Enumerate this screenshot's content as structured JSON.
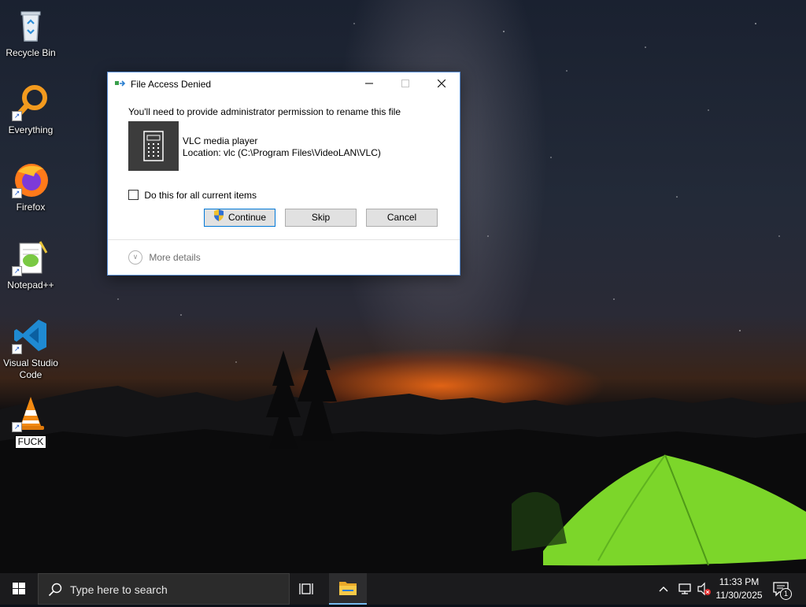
{
  "desktop": {
    "icons": [
      {
        "label": "Recycle Bin",
        "icon": "recycle-bin-icon"
      },
      {
        "label": "Everything",
        "icon": "everything-search-icon"
      },
      {
        "label": "Firefox",
        "icon": "firefox-icon"
      },
      {
        "label": "Notepad++",
        "icon": "notepad-plus-plus-icon"
      },
      {
        "label": "Visual Studio Code",
        "icon": "vscode-icon"
      },
      {
        "label": "FUCK",
        "icon": "vlc-cone-icon"
      }
    ]
  },
  "dialog": {
    "title": "File Access Denied",
    "message": "You'll need to provide administrator permission to rename this file",
    "file_name": "VLC media player",
    "file_location": "Location: vlc (C:\\Program Files\\VideoLAN\\VLC)",
    "checkbox_label": "Do this for all current items",
    "checkbox_checked": false,
    "buttons": {
      "continue": "Continue",
      "skip": "Skip",
      "cancel": "Cancel"
    },
    "more_details": "More details"
  },
  "taskbar": {
    "search_placeholder": "Type here to search",
    "time": "11:33 PM",
    "date": "11/30/2025",
    "notification_count": "1"
  },
  "colors": {
    "accent": "#0078d7",
    "taskbar": "#1b1b1d"
  }
}
